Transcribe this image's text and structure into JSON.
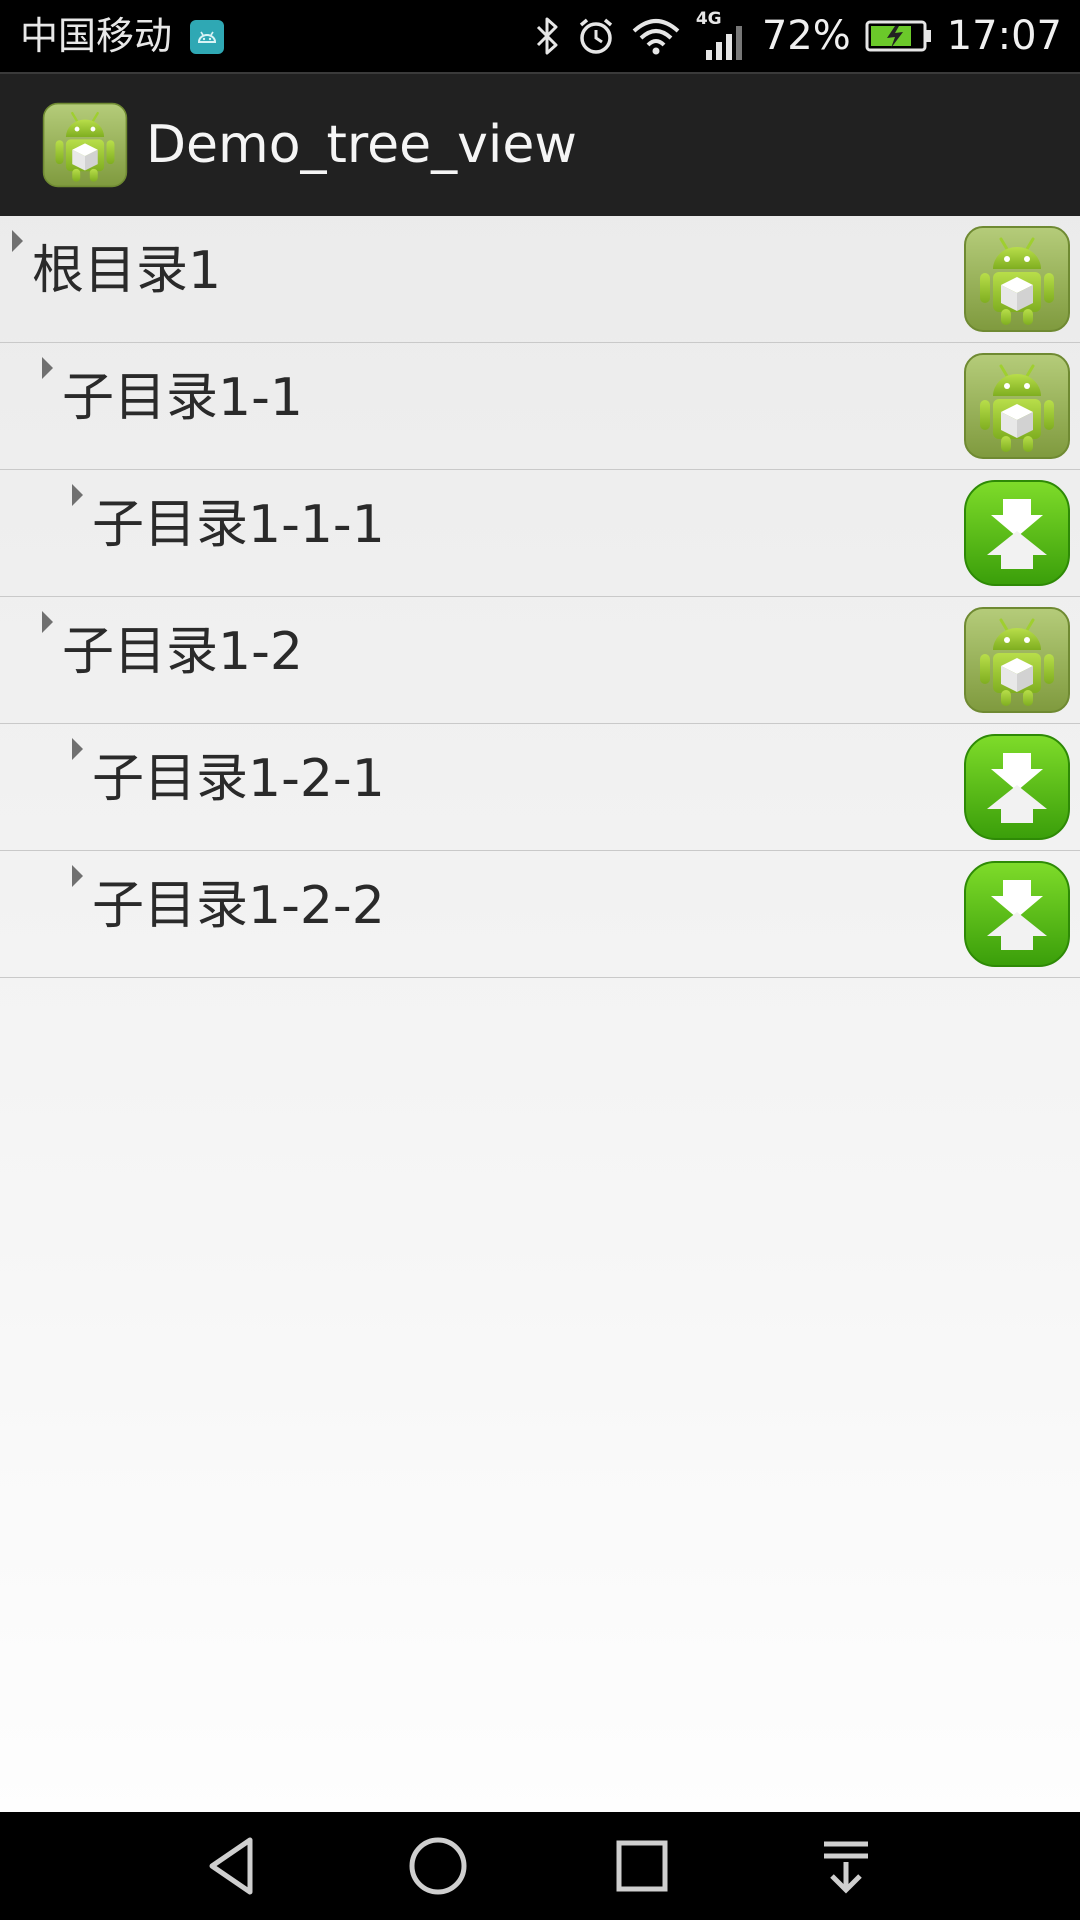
{
  "status_bar": {
    "carrier": "中国移动",
    "network_type": "4G",
    "battery_percent": "72%",
    "time": "17:07",
    "icons": [
      "android-debug-icon",
      "bluetooth-icon",
      "alarm-icon",
      "wifi-icon",
      "signal-icon",
      "battery-charging-icon"
    ]
  },
  "action_bar": {
    "title": "Demo_tree_view",
    "icon": "android-app-icon"
  },
  "tree": {
    "items": [
      {
        "label": "根目录1",
        "level": 0,
        "icon": "android-folder-icon"
      },
      {
        "label": "子目录1-1",
        "level": 1,
        "icon": "android-folder-icon"
      },
      {
        "label": "子目录1-1-1",
        "level": 2,
        "icon": "download-upload-icon"
      },
      {
        "label": "子目录1-2",
        "level": 1,
        "icon": "android-folder-icon"
      },
      {
        "label": "子目录1-2-1",
        "level": 2,
        "icon": "download-upload-icon"
      },
      {
        "label": "子目录1-2-2",
        "level": 2,
        "icon": "download-upload-icon"
      }
    ]
  },
  "nav_bar": {
    "buttons": [
      "back-icon",
      "home-icon",
      "recents-icon",
      "notification-pull-icon"
    ]
  },
  "colors": {
    "status_bar_bg": "#000000",
    "action_bar_bg": "#212121",
    "android_green": "#9ac43a",
    "download_green": "#4fb10f"
  }
}
